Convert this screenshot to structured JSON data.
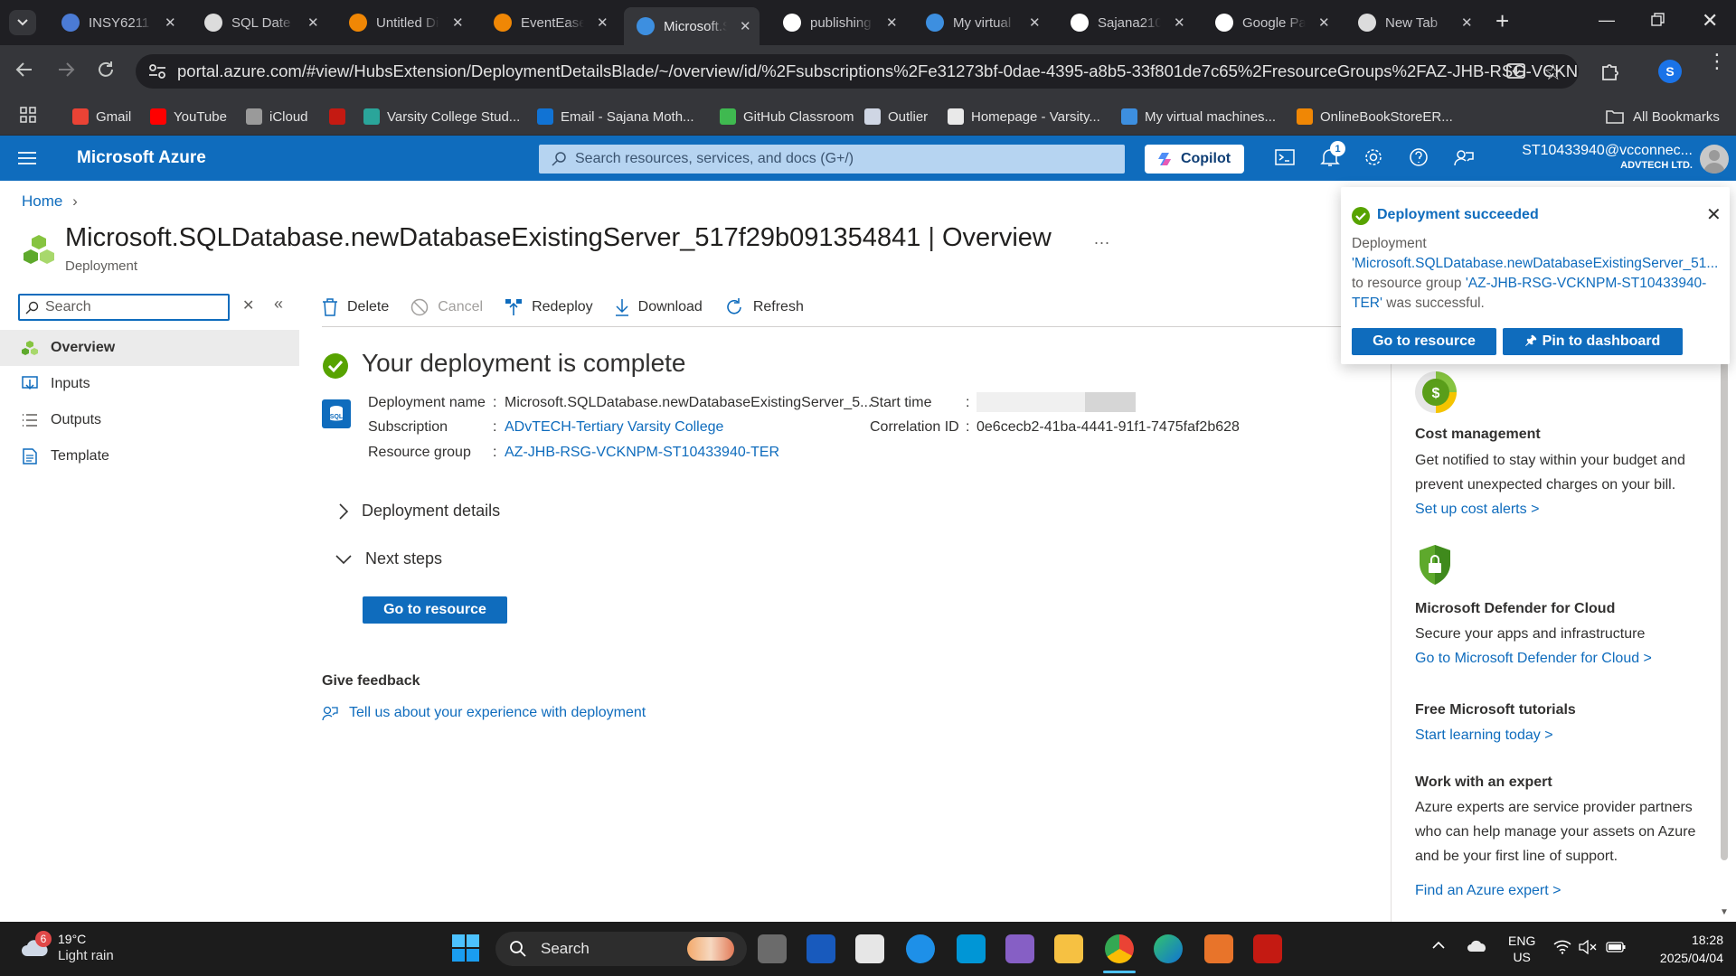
{
  "browser": {
    "tabs": [
      {
        "title": "INSY6211 -",
        "icon": "bookmark-icon",
        "color": "#4b7bd5"
      },
      {
        "title": "SQL Date C",
        "icon": "openai-icon",
        "color": "#dcdcdc"
      },
      {
        "title": "Untitled Di",
        "icon": "drawio-icon",
        "color": "#f08705"
      },
      {
        "title": "EventEase",
        "icon": "drawio-icon",
        "color": "#f08705"
      },
      {
        "title": "Microsoft.S",
        "icon": "azure-icon",
        "color": "#3d8fe0"
      },
      {
        "title": "publishing",
        "icon": "google-icon",
        "color": "#ffffff"
      },
      {
        "title": "My virtual",
        "icon": "azure-icon",
        "color": "#3d8fe0"
      },
      {
        "title": "Sajana210",
        "icon": "github-icon",
        "color": "#ffffff"
      },
      {
        "title": "Google Pa",
        "icon": "google-pay-icon",
        "color": "#ffffff"
      },
      {
        "title": "New Tab",
        "icon": "chrome-icon",
        "color": "#dcdcdc"
      }
    ],
    "url": "portal.azure.com/#view/HubsExtension/DeploymentDetailsBlade/~/overview/id/%2Fsubscriptions%2Fe31273bf-0dae-4395-a8b5-33f801de7c65%2FresourceGroups%2FAZ-JHB-RSG-VCKN...",
    "profile_initial": "S",
    "bookmarks": [
      {
        "label": "Gmail",
        "icon": "gmail-icon",
        "color": "#ea4335"
      },
      {
        "label": "YouTube",
        "icon": "youtube-icon",
        "color": "#ff0000"
      },
      {
        "label": "iCloud",
        "icon": "apple-icon",
        "color": "#9a9a9a"
      },
      {
        "label": "",
        "icon": "acrobat-icon",
        "color": "#c41a12"
      },
      {
        "label": "Varsity College Stud...",
        "icon": "varsity-icon",
        "color": "#2aa59a"
      },
      {
        "label": "Email - Sajana Moth...",
        "icon": "outlook-icon",
        "color": "#1173d4"
      },
      {
        "label": "GitHub Classroom",
        "icon": "github-classroom-icon",
        "color": "#3fb950"
      },
      {
        "label": "Outlier",
        "icon": "outlier-icon",
        "color": "#cfd6e4"
      },
      {
        "label": "Homepage - Varsity...",
        "icon": "homepage-icon",
        "color": "#e9e9e9"
      },
      {
        "label": "My virtual machines...",
        "icon": "azure-icon",
        "color": "#3d8fe0"
      },
      {
        "label": "OnlineBookStoreER...",
        "icon": "drawio-icon",
        "color": "#f08705"
      }
    ],
    "all_bookmarks": "All Bookmarks"
  },
  "azure": {
    "brand": "Microsoft Azure",
    "search_placeholder": "Search resources, services, and docs (G+/)",
    "copilot": "Copilot",
    "notification_count": "1",
    "account_email": "ST10433940@vcconnec...",
    "account_org": "ADVTECH LTD."
  },
  "page": {
    "breadcrumb_home": "Home",
    "title": "Microsoft.SQLDatabase.newDatabaseExistingServer_517f29b091354841",
    "title_suffix": "Overview",
    "subtitle": "Deployment",
    "more": "...",
    "search_placeholder": "Search",
    "nav": [
      {
        "label": "Overview",
        "icon": "overview-icon"
      },
      {
        "label": "Inputs",
        "icon": "inputs-icon"
      },
      {
        "label": "Outputs",
        "icon": "outputs-icon"
      },
      {
        "label": "Template",
        "icon": "template-icon"
      }
    ],
    "toolbar": {
      "delete": "Delete",
      "cancel": "Cancel",
      "redeploy": "Redeploy",
      "download": "Download",
      "refresh": "Refresh"
    },
    "status_title": "Your deployment is complete",
    "details": {
      "deployment_name_label": "Deployment name",
      "deployment_name": "Microsoft.SQLDatabase.newDatabaseExistingServer_5...",
      "subscription_label": "Subscription",
      "subscription": "ADvTECH-Tertiary Varsity College",
      "resource_group_label": "Resource group",
      "resource_group": "AZ-JHB-RSG-VCKNPM-ST10433940-TER",
      "start_time_label": "Start time",
      "correlation_label": "Correlation ID",
      "correlation": "0e6cecb2-41ba-4441-91f1-7475faf2b628",
      "colon": ":"
    },
    "deployment_details": "Deployment details",
    "next_steps": "Next steps",
    "go_to_resource": "Go to resource",
    "give_feedback": "Give feedback",
    "feedback_link": "Tell us about your experience with deployment"
  },
  "right_panel": {
    "cost_title": "Cost management",
    "cost_text": "Get notified to stay within your budget and prevent unexpected charges on your bill.",
    "cost_link": "Set up cost alerts >",
    "defender_title": "Microsoft Defender for Cloud",
    "defender_text": "Secure your apps and infrastructure",
    "defender_link": "Go to Microsoft Defender for Cloud >",
    "tutorials_title": "Free Microsoft tutorials",
    "tutorials_link": "Start learning today >",
    "expert_title": "Work with an expert",
    "expert_text": "Azure experts are service provider partners who can help manage your assets on Azure and be your first line of support.",
    "expert_link": "Find an Azure expert >"
  },
  "toast": {
    "title": "Deployment succeeded",
    "line1": "Deployment",
    "deployment": "'Microsoft.SQLDatabase.newDatabaseExistingServer_51...",
    "mid": "to resource group",
    "group": "'AZ-JHB-RSG-VCKNPM-ST10433940-TER'",
    "end": "was successful.",
    "go": "Go to resource",
    "pin": "Pin to dashboard"
  },
  "taskbar": {
    "weather_badge": "6",
    "temperature": "19°C",
    "condition": "Light rain",
    "search": "Search",
    "lang1": "ENG",
    "lang2": "US",
    "time": "18:28",
    "date": "2025/04/04"
  }
}
